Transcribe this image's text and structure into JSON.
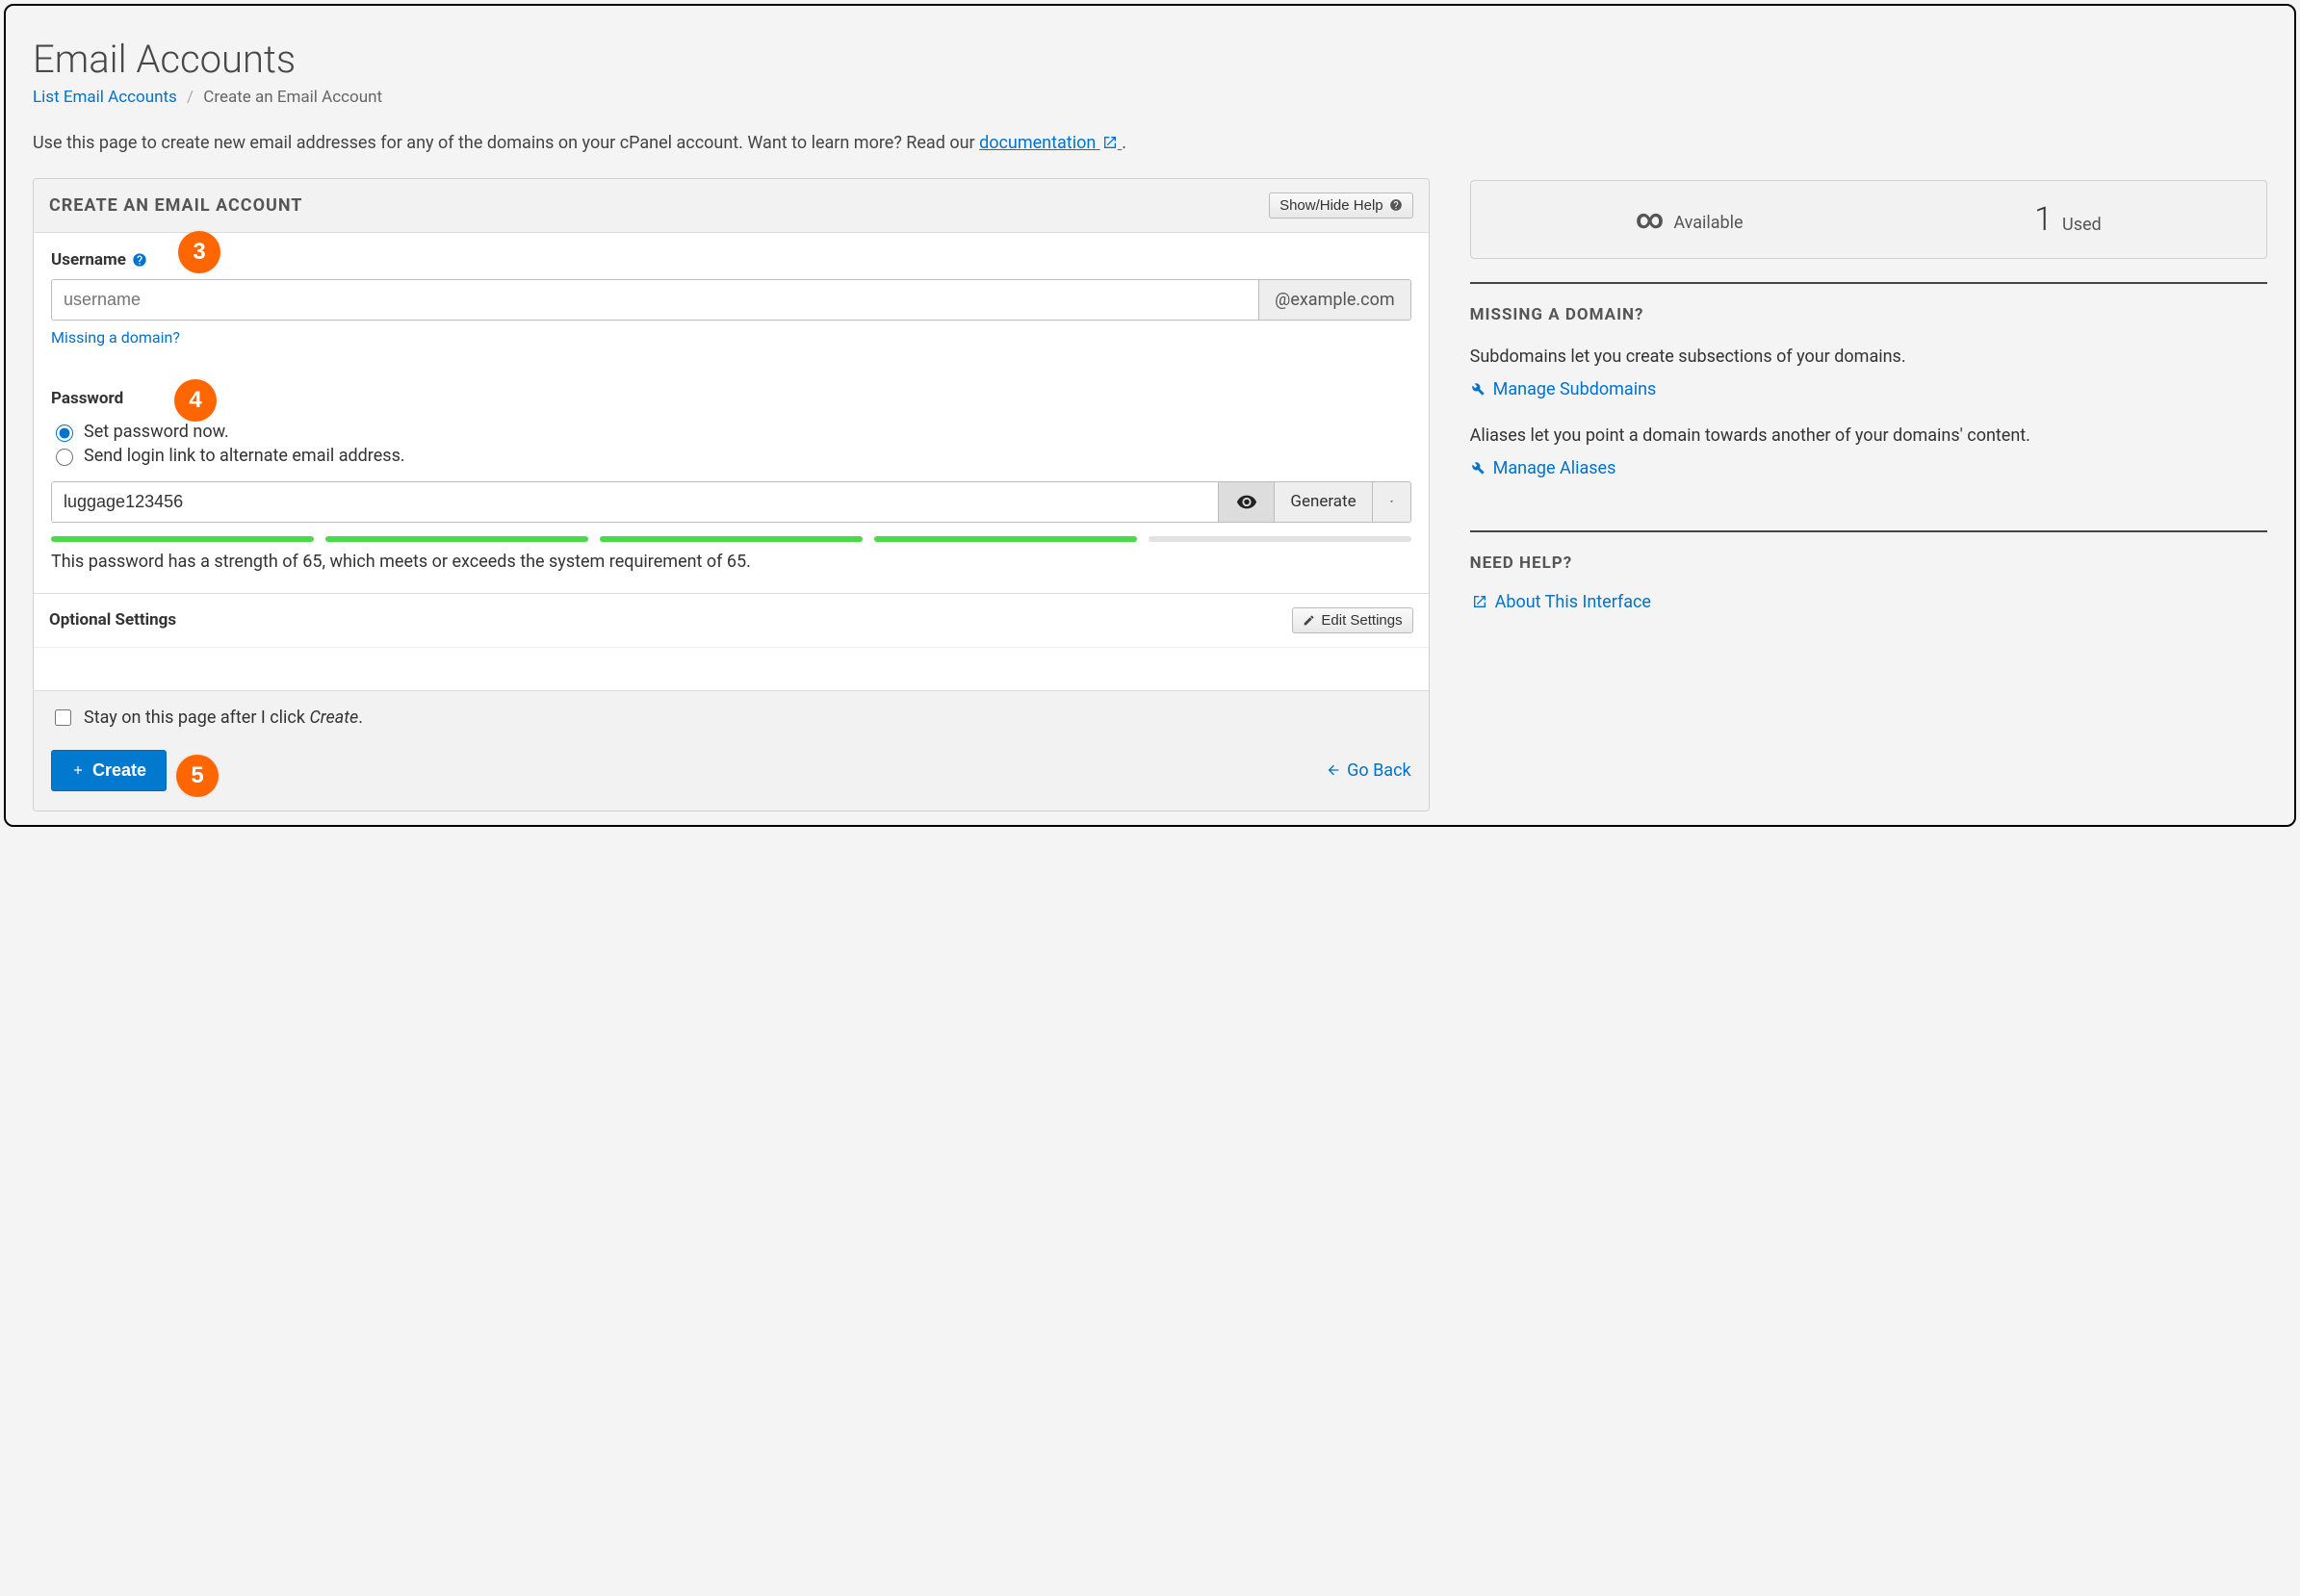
{
  "page": {
    "title": "Email Accounts",
    "breadcrumb_link": "List Email Accounts",
    "breadcrumb_current": "Create an Email Account",
    "intro_pre": "Use this page to create new email addresses for any of the domains on your cPanel account. Want to learn more? Read our ",
    "intro_link": "documentation",
    "intro_post": " ."
  },
  "panel": {
    "heading": "CREATE AN EMAIL ACCOUNT",
    "show_hide_help": "Show/Hide Help"
  },
  "steps": {
    "s3": "3",
    "s4": "4",
    "s5": "5"
  },
  "username": {
    "label": "Username",
    "placeholder": "username",
    "value": "",
    "domain_suffix": "@example.com",
    "missing_link": "Missing a domain?"
  },
  "password": {
    "label": "Password",
    "opt_now": "Set password now.",
    "opt_link": "Send login link to alternate email address.",
    "selected": "now",
    "value": "luggage123456",
    "generate": "Generate",
    "strength_filled": 4,
    "strength_total": 5,
    "strength_msg": "This password has a strength of 65, which meets or exceeds the system requirement of 65."
  },
  "optional": {
    "heading": "Optional Settings",
    "edit": "Edit Settings"
  },
  "footer": {
    "stay_pre": "Stay on this page after I click ",
    "stay_em": "Create",
    "stay_post": ".",
    "create": "Create",
    "go_back": "Go Back"
  },
  "sidebar": {
    "available_label": "Available",
    "used_value": "1",
    "used_label": "Used",
    "missing_heading": "MISSING A DOMAIN?",
    "sub_p": "Subdomains let you create subsections of your domains.",
    "sub_link": "Manage Subdomains",
    "alias_p": "Aliases let you point a domain towards another of your domains' content.",
    "alias_link": "Manage Aliases",
    "help_heading": "NEED HELP?",
    "about_link": "About This Interface"
  }
}
